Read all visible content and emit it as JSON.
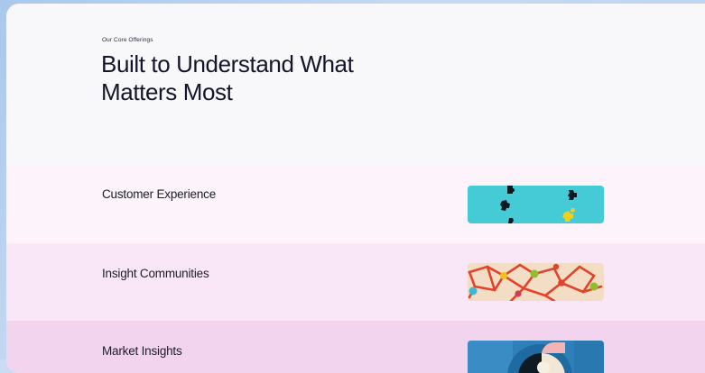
{
  "section": {
    "eyebrow": "Our Core Offerings",
    "headline": "Built to Understand What Matters Most"
  },
  "offerings": [
    {
      "label": "Customer Experience",
      "image": "teal-puzzle-pieces-image",
      "accent": "#3fc9d4"
    },
    {
      "label": "Insight Communities",
      "image": "connected-network-image",
      "accent": "#f2dcc2"
    },
    {
      "label": "Market Insights",
      "image": "abstract-shapes-image",
      "accent": "#2f7fb8"
    }
  ],
  "colors": {
    "background_outer": "#c6d9f2",
    "card": "#f8f8fa",
    "row_1": "#fcf3fb",
    "row_2": "#f9e7f7",
    "row_3": "#f2d4ef",
    "text": "#14142a"
  }
}
